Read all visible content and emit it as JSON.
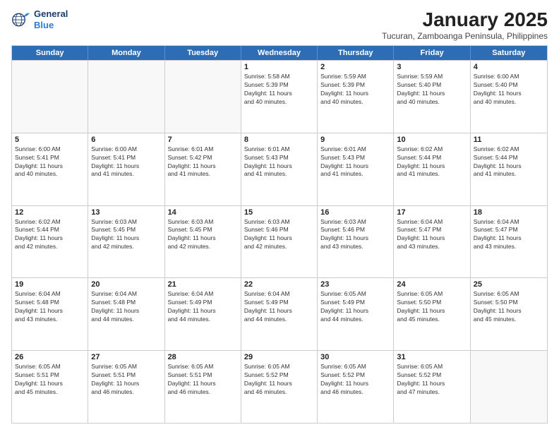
{
  "logo": {
    "line1": "General",
    "line2": "Blue"
  },
  "title": "January 2025",
  "subtitle": "Tucuran, Zamboanga Peninsula, Philippines",
  "days": [
    "Sunday",
    "Monday",
    "Tuesday",
    "Wednesday",
    "Thursday",
    "Friday",
    "Saturday"
  ],
  "rows": [
    [
      {
        "day": "",
        "text": ""
      },
      {
        "day": "",
        "text": ""
      },
      {
        "day": "",
        "text": ""
      },
      {
        "day": "1",
        "text": "Sunrise: 5:58 AM\nSunset: 5:39 PM\nDaylight: 11 hours\nand 40 minutes."
      },
      {
        "day": "2",
        "text": "Sunrise: 5:59 AM\nSunset: 5:39 PM\nDaylight: 11 hours\nand 40 minutes."
      },
      {
        "day": "3",
        "text": "Sunrise: 5:59 AM\nSunset: 5:40 PM\nDaylight: 11 hours\nand 40 minutes."
      },
      {
        "day": "4",
        "text": "Sunrise: 6:00 AM\nSunset: 5:40 PM\nDaylight: 11 hours\nand 40 minutes."
      }
    ],
    [
      {
        "day": "5",
        "text": "Sunrise: 6:00 AM\nSunset: 5:41 PM\nDaylight: 11 hours\nand 40 minutes."
      },
      {
        "day": "6",
        "text": "Sunrise: 6:00 AM\nSunset: 5:41 PM\nDaylight: 11 hours\nand 41 minutes."
      },
      {
        "day": "7",
        "text": "Sunrise: 6:01 AM\nSunset: 5:42 PM\nDaylight: 11 hours\nand 41 minutes."
      },
      {
        "day": "8",
        "text": "Sunrise: 6:01 AM\nSunset: 5:43 PM\nDaylight: 11 hours\nand 41 minutes."
      },
      {
        "day": "9",
        "text": "Sunrise: 6:01 AM\nSunset: 5:43 PM\nDaylight: 11 hours\nand 41 minutes."
      },
      {
        "day": "10",
        "text": "Sunrise: 6:02 AM\nSunset: 5:44 PM\nDaylight: 11 hours\nand 41 minutes."
      },
      {
        "day": "11",
        "text": "Sunrise: 6:02 AM\nSunset: 5:44 PM\nDaylight: 11 hours\nand 41 minutes."
      }
    ],
    [
      {
        "day": "12",
        "text": "Sunrise: 6:02 AM\nSunset: 5:44 PM\nDaylight: 11 hours\nand 42 minutes."
      },
      {
        "day": "13",
        "text": "Sunrise: 6:03 AM\nSunset: 5:45 PM\nDaylight: 11 hours\nand 42 minutes."
      },
      {
        "day": "14",
        "text": "Sunrise: 6:03 AM\nSunset: 5:45 PM\nDaylight: 11 hours\nand 42 minutes."
      },
      {
        "day": "15",
        "text": "Sunrise: 6:03 AM\nSunset: 5:46 PM\nDaylight: 11 hours\nand 42 minutes."
      },
      {
        "day": "16",
        "text": "Sunrise: 6:03 AM\nSunset: 5:46 PM\nDaylight: 11 hours\nand 43 minutes."
      },
      {
        "day": "17",
        "text": "Sunrise: 6:04 AM\nSunset: 5:47 PM\nDaylight: 11 hours\nand 43 minutes."
      },
      {
        "day": "18",
        "text": "Sunrise: 6:04 AM\nSunset: 5:47 PM\nDaylight: 11 hours\nand 43 minutes."
      }
    ],
    [
      {
        "day": "19",
        "text": "Sunrise: 6:04 AM\nSunset: 5:48 PM\nDaylight: 11 hours\nand 43 minutes."
      },
      {
        "day": "20",
        "text": "Sunrise: 6:04 AM\nSunset: 5:48 PM\nDaylight: 11 hours\nand 44 minutes."
      },
      {
        "day": "21",
        "text": "Sunrise: 6:04 AM\nSunset: 5:49 PM\nDaylight: 11 hours\nand 44 minutes."
      },
      {
        "day": "22",
        "text": "Sunrise: 6:04 AM\nSunset: 5:49 PM\nDaylight: 11 hours\nand 44 minutes."
      },
      {
        "day": "23",
        "text": "Sunrise: 6:05 AM\nSunset: 5:49 PM\nDaylight: 11 hours\nand 44 minutes."
      },
      {
        "day": "24",
        "text": "Sunrise: 6:05 AM\nSunset: 5:50 PM\nDaylight: 11 hours\nand 45 minutes."
      },
      {
        "day": "25",
        "text": "Sunrise: 6:05 AM\nSunset: 5:50 PM\nDaylight: 11 hours\nand 45 minutes."
      }
    ],
    [
      {
        "day": "26",
        "text": "Sunrise: 6:05 AM\nSunset: 5:51 PM\nDaylight: 11 hours\nand 45 minutes."
      },
      {
        "day": "27",
        "text": "Sunrise: 6:05 AM\nSunset: 5:51 PM\nDaylight: 11 hours\nand 46 minutes."
      },
      {
        "day": "28",
        "text": "Sunrise: 6:05 AM\nSunset: 5:51 PM\nDaylight: 11 hours\nand 46 minutes."
      },
      {
        "day": "29",
        "text": "Sunrise: 6:05 AM\nSunset: 5:52 PM\nDaylight: 11 hours\nand 46 minutes."
      },
      {
        "day": "30",
        "text": "Sunrise: 6:05 AM\nSunset: 5:52 PM\nDaylight: 11 hours\nand 46 minutes."
      },
      {
        "day": "31",
        "text": "Sunrise: 6:05 AM\nSunset: 5:52 PM\nDaylight: 11 hours\nand 47 minutes."
      },
      {
        "day": "",
        "text": ""
      }
    ]
  ]
}
